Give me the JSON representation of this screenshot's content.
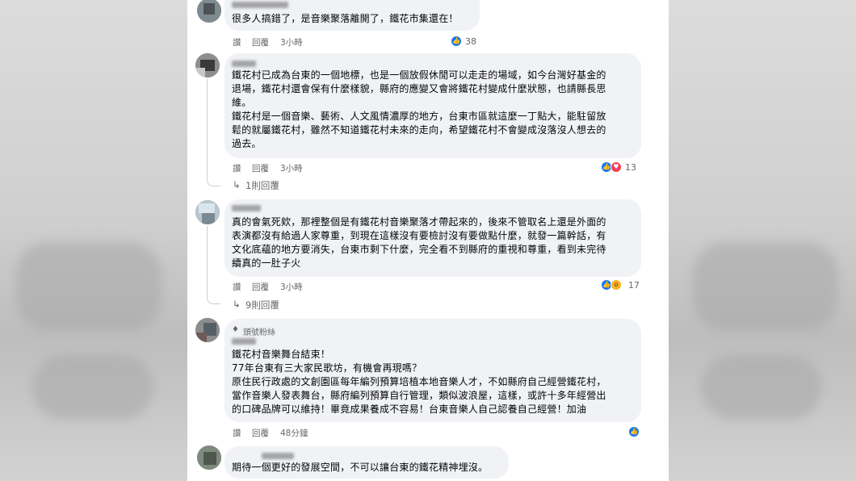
{
  "comments": [
    {
      "text": "很多人搞錯了，是音樂聚落離開了，鐵花市集還在！",
      "actions": {
        "like": "讚",
        "reply": "回覆",
        "time": "3小時"
      },
      "reaction_count": "38",
      "reactions": [
        "like"
      ]
    },
    {
      "text": "鐵花村已成為台東的一個地標，也是一個放假休閒可以走走的場域，如今台灣好基金的\n退場，鐵花村還會保有什麼樣貌，縣府的應變又會將鐵花村變成什麼狀態，也請縣長思\n維。\n鐵花村是一個音樂、藝術、人文風情濃厚的地方，台東市區就這麼一丁點大，能駐留放\n鬆的就屬鐵花村，雖然不知道鐵花村未來的走向，希望鐵花村不會變成沒落沒人想去的\n過去。",
      "actions": {
        "like": "讚",
        "reply": "回覆",
        "time": "3小時"
      },
      "reaction_count": "13",
      "reactions": [
        "like",
        "love"
      ],
      "replies_label": "1則回覆"
    },
    {
      "text": "真的會氣死欸，那裡整個是有鐵花村音樂聚落才帶起來的，後來不管取名上還是外面的\n表演都沒有給過人家尊重，到現在這樣沒有要檢討沒有要做點什麼，就發一篇幹話，有\n文化底蘊的地方要消失，台東市剩下什麼，完全看不到縣府的重視和尊重，看到未完待\n續真的一肚子火",
      "actions": {
        "like": "讚",
        "reply": "回覆",
        "time": "3小時"
      },
      "reaction_count": "17",
      "reactions": [
        "like",
        "wow"
      ],
      "replies_label": "9則回覆"
    },
    {
      "badge": "頭號粉絲",
      "text": "鐵花村音樂舞台結束！\n77年台東有三大家民歌坊，有機會再現嗎？\n原住民行政處的文創園區每年編列預算培植本地音樂人才，不如縣府自己經營鐵花村，\n當作音樂人發表舞台，縣府編列預算自行管理，類似波浪屋，這樣，或許十多年經營出\n的口碑品牌可以維持！畢竟成果養成不容易！台東音樂人自己認養自己經營！加油",
      "actions": {
        "like": "讚",
        "reply": "回覆",
        "time": "48分鐘"
      },
      "reactions": [
        "like"
      ]
    },
    {
      "text": "期待一個更好的發展空間，不可以讓台東的鐵花精神埋沒。"
    }
  ],
  "icons": {
    "like": "thumbs-up-icon",
    "love": "heart-icon",
    "wow": "wow-face-icon",
    "reply_arrow": "reply-arrow-icon",
    "badge": "diamond-badge-icon"
  },
  "colors": {
    "bubble": "#f0f2f5",
    "like": "#1877f2",
    "love": "#f33e58",
    "wow": "#f7b125",
    "meta": "#65676b"
  }
}
